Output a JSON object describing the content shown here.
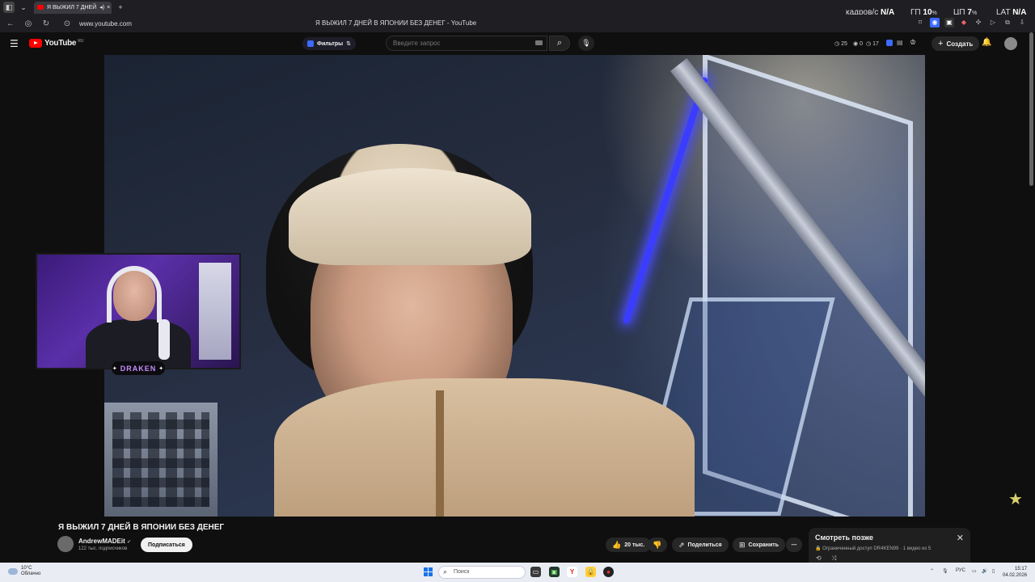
{
  "browser": {
    "tab_title": "Я ВЫЖИЛ 7 ДНЕЙ",
    "url": "www.youtube.com",
    "page_title": "Я ВЫЖИЛ 7 ДНЕЙ В ЯПОНИИ БЕЗ ДЕНЕГ - YouTube",
    "new_tab": "+"
  },
  "overlay": {
    "fps_label": "кадров/с",
    "fps_value": "N/A",
    "gpu_label": "ГП",
    "gpu_value": "10",
    "gpu_unit": "%",
    "cpu_label": "ЦП",
    "cpu_value": "7",
    "cpu_unit": "%",
    "lat_label": "LAT",
    "lat_value": "N/A"
  },
  "youtube": {
    "logo_text": "YouTube",
    "region": "RU",
    "filters_label": "Фильтры",
    "search_placeholder": "Введите запрос",
    "stat_a": "25",
    "stat_b": "0",
    "stat_c": "17",
    "create_label": "Создать"
  },
  "video": {
    "title": "Я ВЫЖИЛ 7 ДНЕЙ В ЯПОНИИ БЕЗ ДЕНЕГ",
    "channel_name": "AndrewMADEit",
    "verified": "✔",
    "subscribers": "122 тыс. подписчиков",
    "subscribe_label": "Подписаться",
    "likes": "20 тыс.",
    "share_label": "Поделиться",
    "save_label": "Сохранить",
    "more": "⋯"
  },
  "facecam": {
    "badge_text": "DRAKEN"
  },
  "watch_later": {
    "title": "Смотреть позже",
    "subtitle": "Ограниченный доступ DR4KEN99 · 1 видео из 5"
  },
  "taskbar": {
    "temp": "10°C",
    "weather": "Облачно",
    "search_placeholder": "Поиск",
    "language": "РУС",
    "time": "15:17",
    "date": "04.02.2026"
  }
}
